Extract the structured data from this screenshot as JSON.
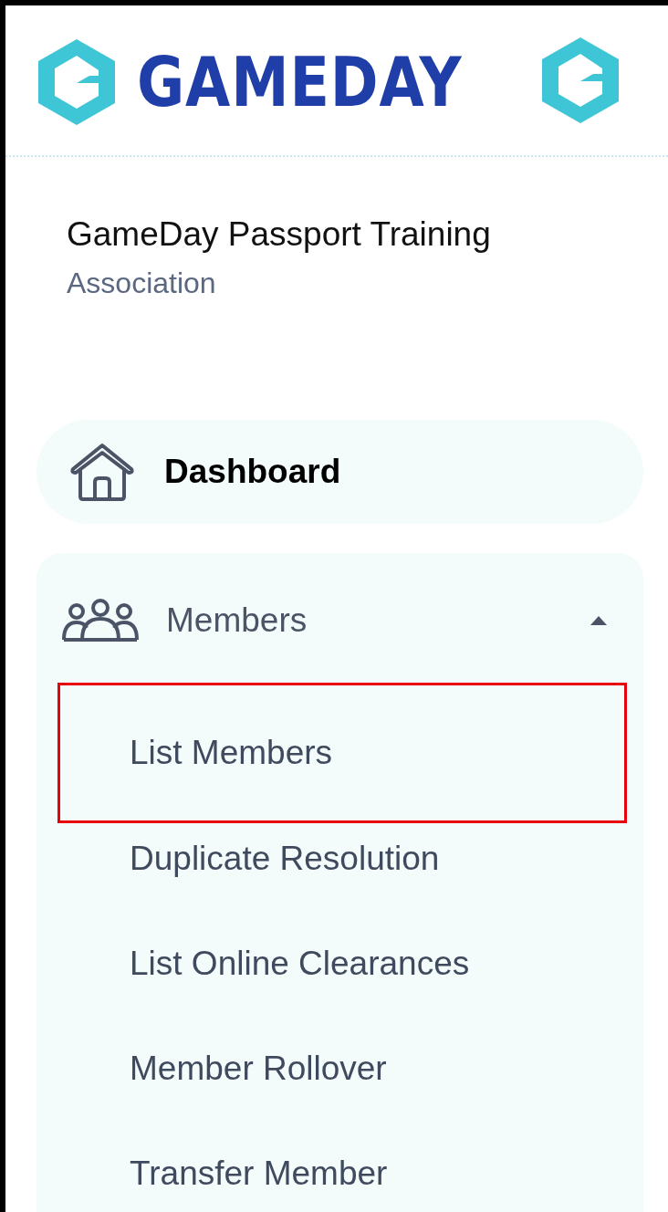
{
  "logo": {
    "wordmark": "GAMEDAY"
  },
  "organisation": {
    "name": "GameDay Passport Training",
    "type": "Association"
  },
  "nav": [
    {
      "kind": "link",
      "label": "Dashboard"
    },
    {
      "kind": "group",
      "label": "Members",
      "expanded": true,
      "children": [
        {
          "label": "List Members",
          "highlighted": true
        },
        {
          "label": "Duplicate Resolution",
          "highlighted": false
        },
        {
          "label": "List Online Clearances",
          "highlighted": false
        },
        {
          "label": "Member Rollover",
          "highlighted": false
        },
        {
          "label": "Transfer Member",
          "highlighted": false
        }
      ]
    }
  ]
}
